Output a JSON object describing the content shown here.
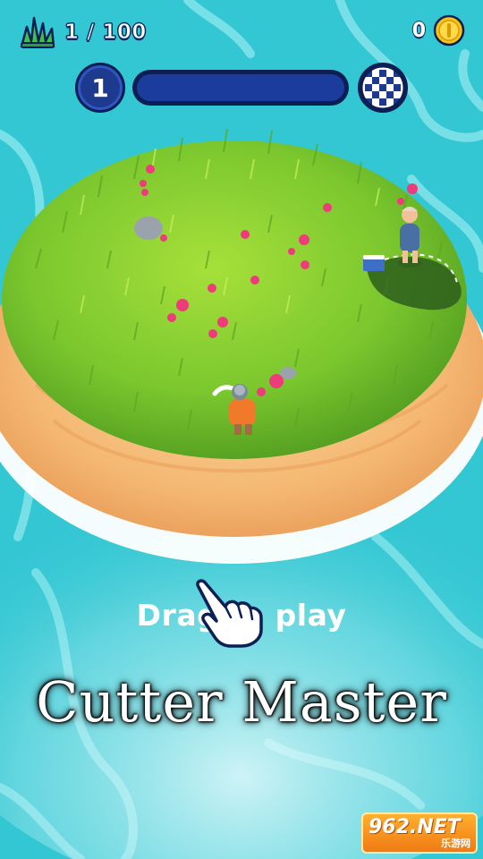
{
  "hud": {
    "grass_count": "1 / 100",
    "grass_icon": "grass-icon",
    "coins": "0",
    "coin_icon": "coin-icon"
  },
  "level": {
    "number": "1",
    "progress": 0.0,
    "finish_icon": "checkered-flag-icon"
  },
  "hint": {
    "text": "Drag to play"
  },
  "title": "Cutter Master",
  "watermark": {
    "main": "962.NET",
    "sub": "乐游网"
  },
  "colors": {
    "water": "#33c7d3",
    "water_light": "#7ee3ea",
    "sand": "#f4b873",
    "grass": "#7bc72e",
    "hud_dark": "#0c1f55",
    "hud_blue": "#1b3c9c",
    "coin": "#f7c21a"
  }
}
